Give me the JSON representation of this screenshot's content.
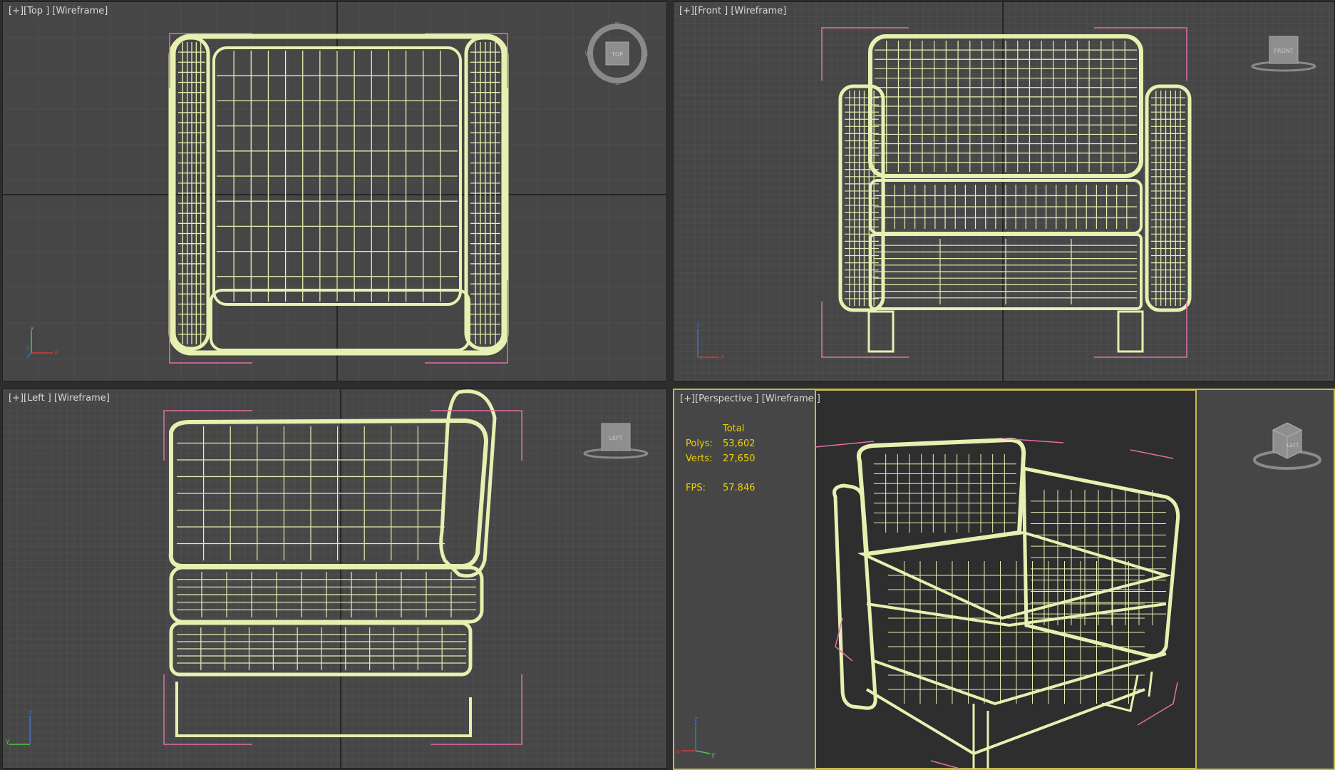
{
  "viewports": {
    "top": {
      "label": {
        "plus": "[+]",
        "view": "[Top ]",
        "mode": "[Wireframe]"
      },
      "cube_face": "TOP",
      "compass": {
        "n": "N",
        "s": "S",
        "e": "E",
        "w": "W"
      },
      "axes": {
        "a": "y",
        "b": "x",
        "c": "z"
      }
    },
    "front": {
      "label": {
        "plus": "[+]",
        "view": "[Front ]",
        "mode": "[Wireframe]"
      },
      "cube_face": "FRONT",
      "axes": {
        "a": "z",
        "b": "x",
        "c": "y"
      }
    },
    "left": {
      "label": {
        "plus": "[+]",
        "view": "[Left ]",
        "mode": "[Wireframe]"
      },
      "cube_face": "LEFT",
      "axes": {
        "a": "z",
        "b": "y",
        "c": "x"
      }
    },
    "perspective": {
      "label": {
        "plus": "[+]",
        "view": "[Perspective ]",
        "mode": "[Wireframe ]"
      },
      "cube_face": "LEFT",
      "stats": {
        "header": "Total",
        "polys_label": "Polys:",
        "polys_value": "53,602",
        "verts_label": "Verts:",
        "verts_value": "27,650",
        "fps_label": "FPS:",
        "fps_value": "57.846"
      },
      "axes": {
        "a": "z",
        "b": "x",
        "c": "y"
      }
    }
  },
  "colors": {
    "viewport_bg": "#464646",
    "grid_minor": "#4f4f4f",
    "grid_major": "#5a5a5a",
    "grid_axis": "#1a1a1a",
    "wire": "#e6f0b0",
    "bracket": "#e36fa8",
    "active_border": "#c8b94a",
    "stats_text": "#f0d000",
    "label_text": "#d9d9d9"
  }
}
